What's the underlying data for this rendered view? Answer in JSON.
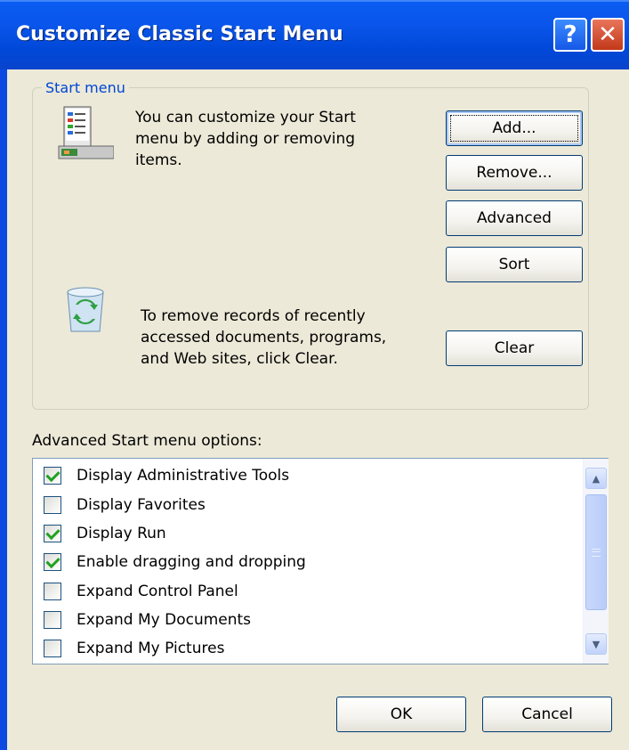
{
  "window": {
    "title": "Customize Classic Start Menu",
    "help_glyph": "?",
    "close_glyph": "✕"
  },
  "start_menu_group": {
    "label": "Start menu",
    "description": [
      "You can customize your Start",
      "menu by adding or removing",
      "items."
    ],
    "clear_description": [
      "To remove records of recently",
      "accessed documents, programs,",
      "and Web sites, click Clear."
    ],
    "buttons": {
      "add": "Add...",
      "remove": "Remove...",
      "advanced": "Advanced",
      "sort": "Sort",
      "clear": "Clear"
    },
    "icons": [
      "start-menu-icon",
      "recycle-bin-icon"
    ]
  },
  "advanced_options": {
    "label": "Advanced Start menu options:",
    "items": [
      {
        "label": "Display Administrative Tools",
        "checked": true
      },
      {
        "label": "Display Favorites",
        "checked": false
      },
      {
        "label": "Display Run",
        "checked": true
      },
      {
        "label": "Enable dragging and dropping",
        "checked": true
      },
      {
        "label": "Expand Control Panel",
        "checked": false
      },
      {
        "label": "Expand My Documents",
        "checked": false
      },
      {
        "label": "Expand My Pictures",
        "checked": false
      }
    ]
  },
  "footer": {
    "ok": "OK",
    "cancel": "Cancel"
  },
  "colors": {
    "titlebar": "#0a55ea",
    "dialog_face": "#ece9d8",
    "group_label": "#0046d5",
    "check": "#21a121"
  }
}
